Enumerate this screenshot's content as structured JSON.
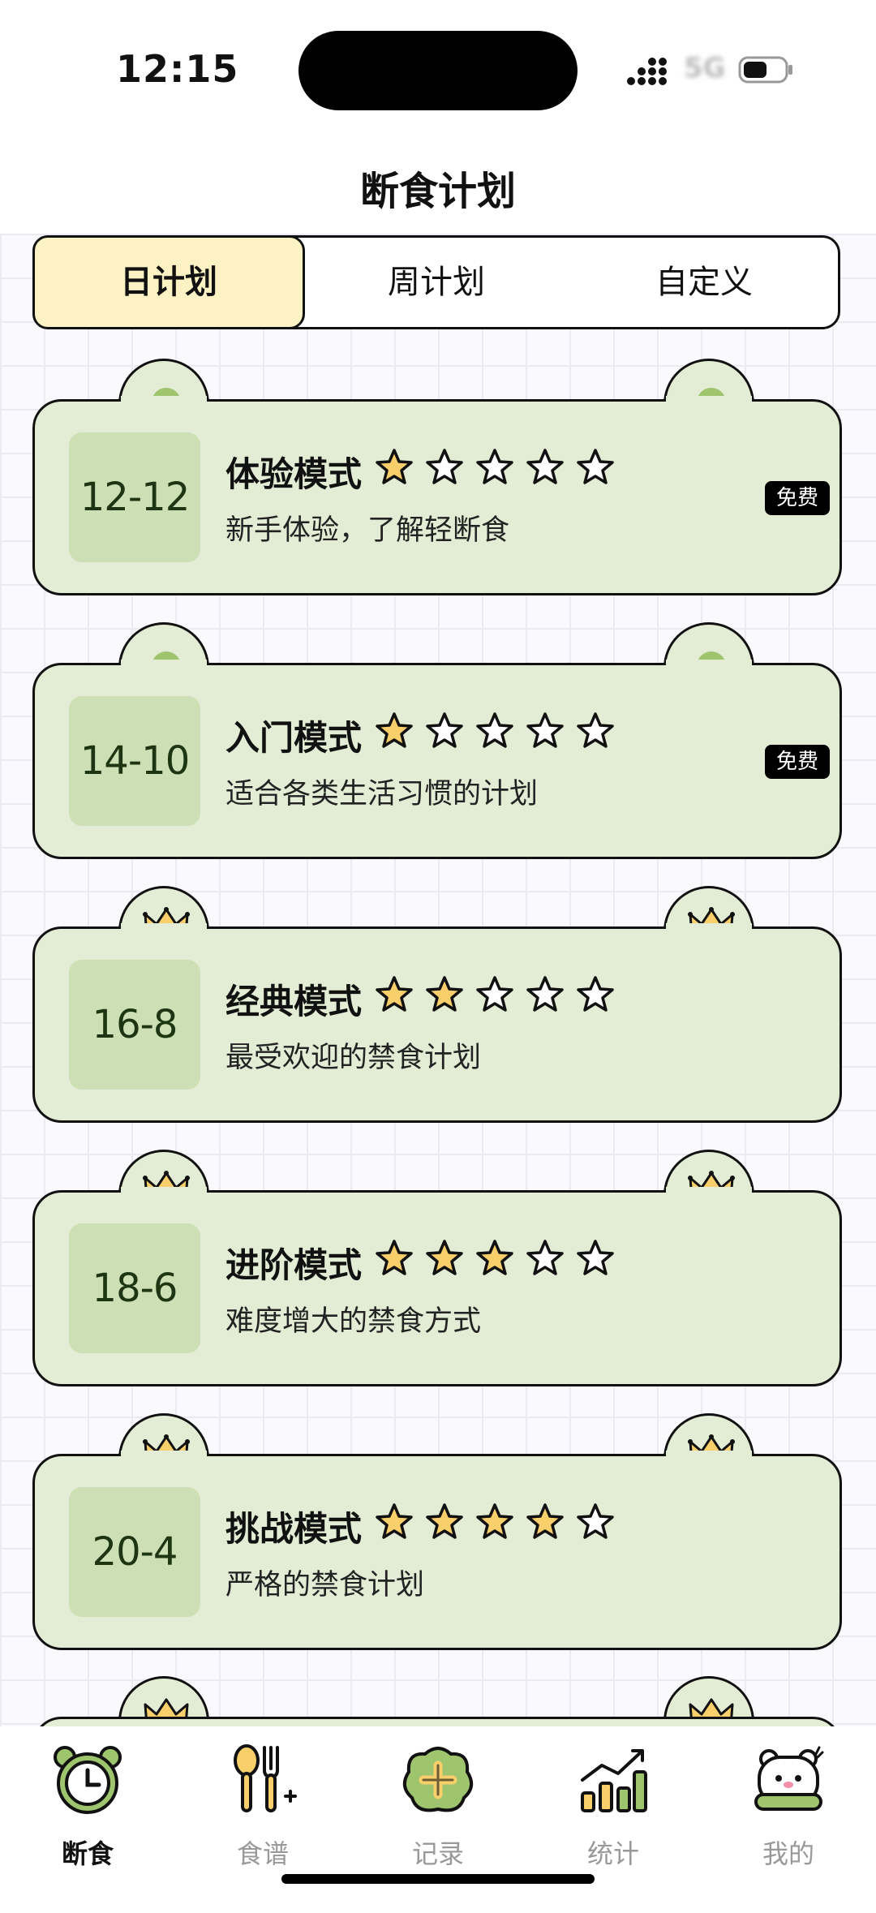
{
  "status": {
    "time": "12:15",
    "network": "5G"
  },
  "page": {
    "title": "断食计划"
  },
  "tabs": [
    {
      "label": "日计划",
      "active": true
    },
    {
      "label": "周计划",
      "active": false
    },
    {
      "label": "自定义",
      "active": false
    }
  ],
  "plans": [
    {
      "ratio": "12-12",
      "name": "体验模式",
      "stars": 1,
      "desc": "新手体验，了解轻断食",
      "badge": "免费",
      "tier": "free"
    },
    {
      "ratio": "14-10",
      "name": "入门模式",
      "stars": 1,
      "desc": "适合各类生活习惯的计划",
      "badge": "免费",
      "tier": "free"
    },
    {
      "ratio": "16-8",
      "name": "经典模式",
      "stars": 2,
      "desc": "最受欢迎的禁食计划",
      "badge": "",
      "tier": "premium"
    },
    {
      "ratio": "18-6",
      "name": "进阶模式",
      "stars": 3,
      "desc": "难度增大的禁食方式",
      "badge": "",
      "tier": "premium"
    },
    {
      "ratio": "20-4",
      "name": "挑战模式",
      "stars": 4,
      "desc": "严格的禁食计划",
      "badge": "",
      "tier": "premium"
    }
  ],
  "nav": [
    {
      "label": "断食",
      "icon": "alarm-clock-icon",
      "active": true
    },
    {
      "label": "食谱",
      "icon": "utensils-icon",
      "active": false
    },
    {
      "label": "记录",
      "icon": "add-record-icon",
      "active": false
    },
    {
      "label": "统计",
      "icon": "bar-chart-icon",
      "active": false
    },
    {
      "label": "我的",
      "icon": "bear-profile-icon",
      "active": false
    }
  ],
  "colors": {
    "card": "#e3ecd4",
    "ratio_box": "#cddfb4",
    "star_fill": "#f8cf6a",
    "active_tab": "#fdf2c4",
    "crown": "#f8cf6a"
  }
}
